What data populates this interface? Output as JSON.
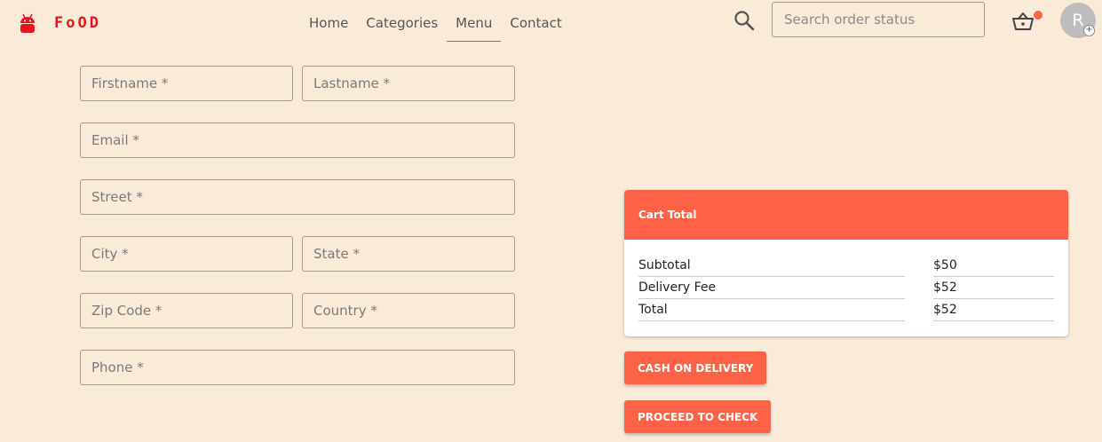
{
  "header": {
    "logo_text": "FoOD",
    "nav": [
      "Home",
      "Categories",
      "Menu",
      "Contact"
    ],
    "active_nav": "Menu",
    "search_placeholder": "Search order status",
    "avatar_initial": "R",
    "avatar_badge": "+"
  },
  "icons": {
    "logo": "android-icon",
    "search": "search-icon",
    "cart": "basket-icon",
    "avatar_add": "plus-icon"
  },
  "colors": {
    "background": "#faebd9",
    "accent": "#ff6347",
    "logo": "#e8141b"
  },
  "form": {
    "firstname": "Firstname *",
    "lastname": "Lastname *",
    "email": "Email *",
    "street": "Street *",
    "city": "City *",
    "state": "State *",
    "zip": "Zip Code *",
    "country": "Country *",
    "phone": "Phone *"
  },
  "cart": {
    "title": "Cart Total",
    "rows": [
      {
        "label": "Subtotal",
        "value": "$50"
      },
      {
        "label": "Delivery Fee",
        "value": "$52"
      },
      {
        "label": "Total",
        "value": "$52"
      }
    ]
  },
  "buttons": {
    "cash": "CASH ON DELIVERY",
    "proceed": "PROCEED TO CHECK"
  }
}
